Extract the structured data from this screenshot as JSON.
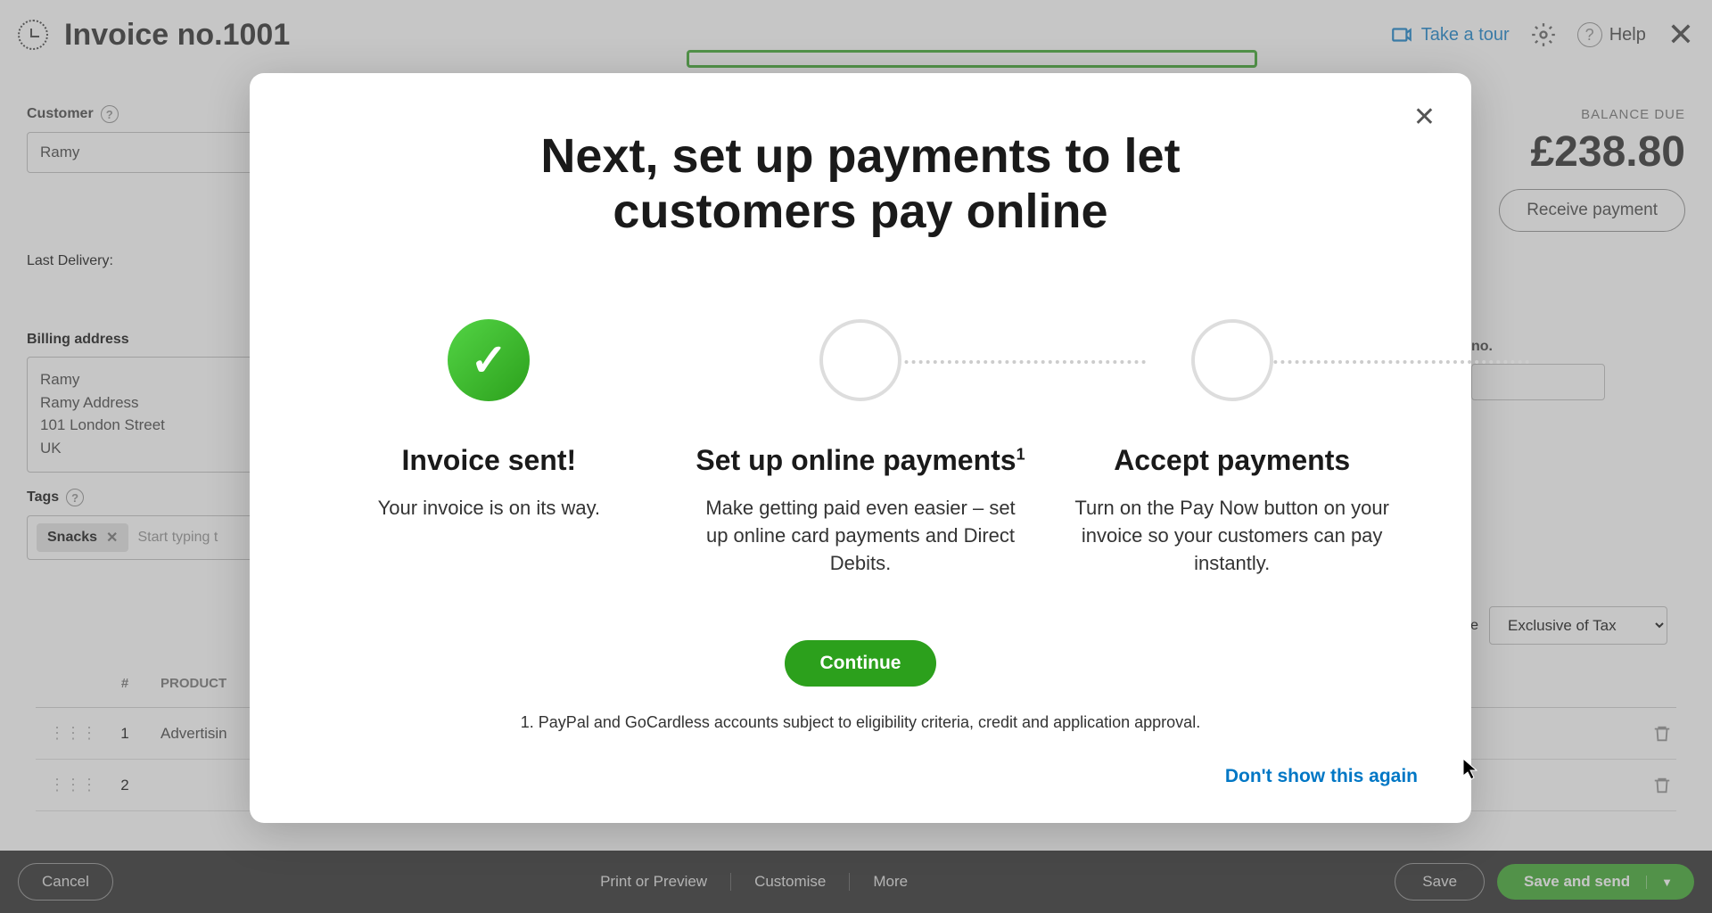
{
  "header": {
    "title": "Invoice no.1001",
    "tour": "Take a tour",
    "help": "Help"
  },
  "balance": {
    "label": "BALANCE DUE",
    "amount": "£238.80",
    "receive": "Receive payment"
  },
  "customer": {
    "label": "Customer",
    "value": "Ramy"
  },
  "delivery": {
    "label": "Last Delivery:"
  },
  "billing": {
    "label": "Billing address",
    "value": "Ramy\nRamy Address\n101 London Street\nUK"
  },
  "tags": {
    "label": "Tags",
    "chip": "Snacks",
    "placeholder": "Start typing t"
  },
  "invoice_no": {
    "label": "no."
  },
  "tax": {
    "label": "are",
    "value": "Exclusive of Tax"
  },
  "table": {
    "col_num": "#",
    "col_product": "PRODUCT",
    "rows": [
      {
        "num": "1",
        "product": "Advertisin"
      },
      {
        "num": "2",
        "product": ""
      }
    ]
  },
  "footer": {
    "cancel": "Cancel",
    "print": "Print or Preview",
    "customise": "Customise",
    "more": "More",
    "save": "Save",
    "save_send": "Save and send"
  },
  "modal": {
    "title": "Next, set up payments to let customers pay online",
    "steps": [
      {
        "title": "Invoice sent!",
        "desc": "Your invoice is on its way."
      },
      {
        "title": "Set up online payments",
        "sup": "1",
        "desc": "Make getting paid even easier – set up online card payments and Direct Debits."
      },
      {
        "title": "Accept payments",
        "desc": "Turn on the Pay Now button on your invoice so your customers can pay instantly."
      }
    ],
    "continue": "Continue",
    "footnote": "1. PayPal and GoCardless accounts subject to eligibility criteria, credit and application approval.",
    "dont_show": "Don't show this again"
  }
}
